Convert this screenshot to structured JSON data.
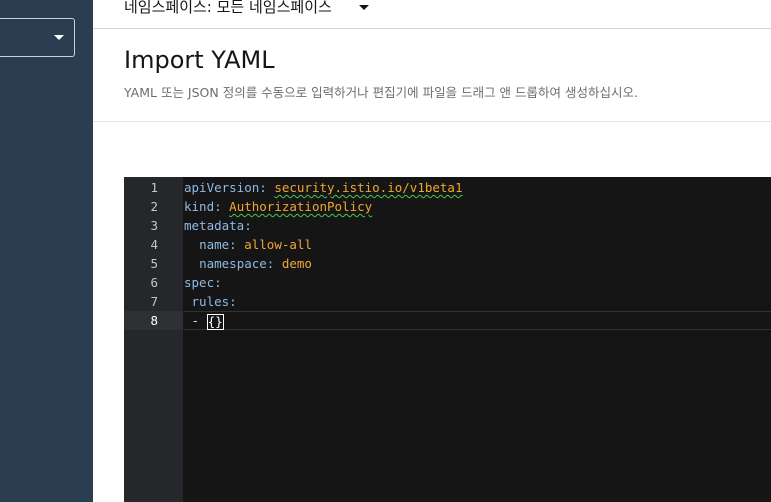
{
  "namespace_bar": {
    "label": "네임스페이스: 모든 네임스페이스"
  },
  "page": {
    "title": "Import YAML",
    "description": "YAML 또는 JSON 정의를 수동으로 입력하거나 편집기에 파일을 드래그 앤 드롭하여 생성하십시오."
  },
  "editor": {
    "line_numbers": [
      "1",
      "2",
      "3",
      "4",
      "5",
      "6",
      "7",
      "8"
    ],
    "current_line": 8,
    "lines": [
      {
        "indent": "",
        "key": "apiVersion",
        "sep": ": ",
        "value": "security.istio.io/v1beta1",
        "squiggle": true
      },
      {
        "indent": "",
        "key": "kind",
        "sep": ": ",
        "value": "AuthorizationPolicy",
        "squiggle": true
      },
      {
        "indent": "",
        "key": "metadata",
        "sep": ":",
        "value": "",
        "squiggle": false
      },
      {
        "indent": "  ",
        "key": "name",
        "sep": ": ",
        "value": "allow-all",
        "squiggle": false
      },
      {
        "indent": "  ",
        "key": "namespace",
        "sep": ": ",
        "value": "demo",
        "squiggle": false
      },
      {
        "indent": "",
        "key": "spec",
        "sep": ":",
        "value": "",
        "squiggle": false
      },
      {
        "indent": " ",
        "key": "rules",
        "sep": ":",
        "value": "",
        "squiggle": false
      },
      {
        "indent": " ",
        "key": "",
        "sep": "- ",
        "value": "{}",
        "squiggle": false
      }
    ]
  },
  "colors": {
    "sidebar_bg": "#2b3e51",
    "editor_bg": "#151515",
    "gutter_bg": "#25272a",
    "yaml_key": "#8fb9e5",
    "yaml_value": "#f0a732",
    "lint_squiggle": "#4ec24e"
  }
}
